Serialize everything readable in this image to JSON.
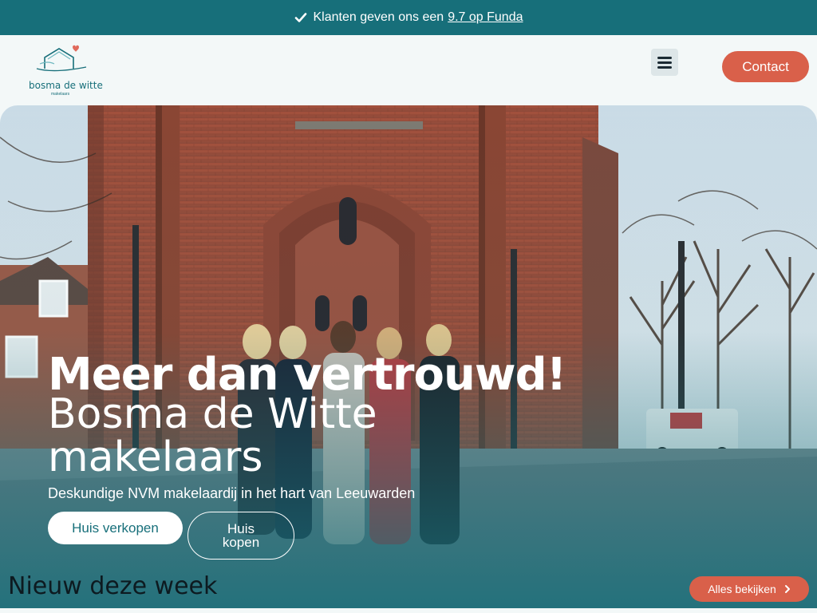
{
  "topbar": {
    "text": "Klanten geven ons een",
    "link": "9.7 op Funda",
    "icon": "check-icon"
  },
  "header": {
    "logo_name": "bosma de witte",
    "logo_sub": "makelaars",
    "menu_icon": "hamburger-icon",
    "contact_label": "Contact"
  },
  "hero": {
    "title": "Meer dan vertrouwd!",
    "subtitle_line1": "Bosma de Witte",
    "subtitle_line2": "makelaars",
    "tagline": "Deskundige NVM makelaardij in het hart van Leeuwarden",
    "cta_sell": "Huis verkopen",
    "cta_buy": "Huis kopen"
  },
  "listings": {
    "title": "Nieuw deze week",
    "view_all": "Alles bekijken",
    "view_all_icon": "chevron-right-icon"
  },
  "colors": {
    "brand_teal": "#176f7a",
    "accent_coral": "#d9604a",
    "background": "#f3f8f8"
  }
}
